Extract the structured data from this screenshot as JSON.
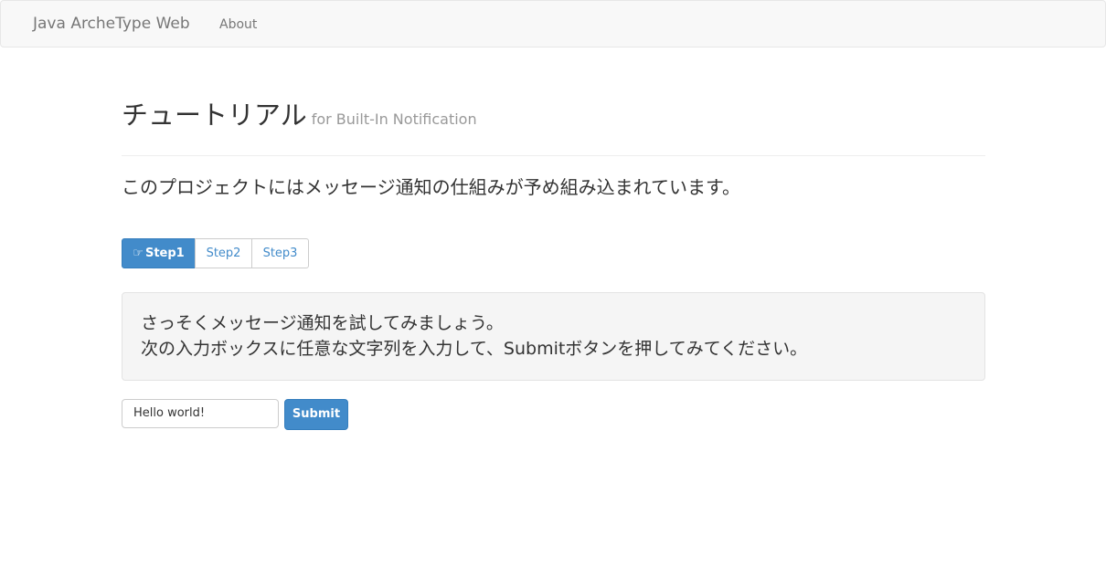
{
  "navbar": {
    "brand": "Java ArcheType Web",
    "links": [
      "About"
    ]
  },
  "header": {
    "title": "チュートリアル",
    "subtitle": "for Built-In Notification"
  },
  "lead": "このプロジェクトにはメッセージ通知の仕組みが予め組み込まれています。",
  "steps": [
    {
      "label": "Step1",
      "icon": "hand-pointing-right-icon",
      "active": true
    },
    {
      "label": "Step2",
      "active": false
    },
    {
      "label": "Step3",
      "active": false
    }
  ],
  "well": {
    "line1": "さっそくメッセージ通知を試してみましょう。",
    "line2": "次の入力ボックスに任意な文字列を入力して、Submitボタンを押してみてください。"
  },
  "form": {
    "input_value": "Hello world!",
    "submit_label": "Submit"
  },
  "colors": {
    "primary": "#428bca",
    "navbar_bg": "#f8f8f8",
    "well_bg": "#f5f5f5"
  }
}
